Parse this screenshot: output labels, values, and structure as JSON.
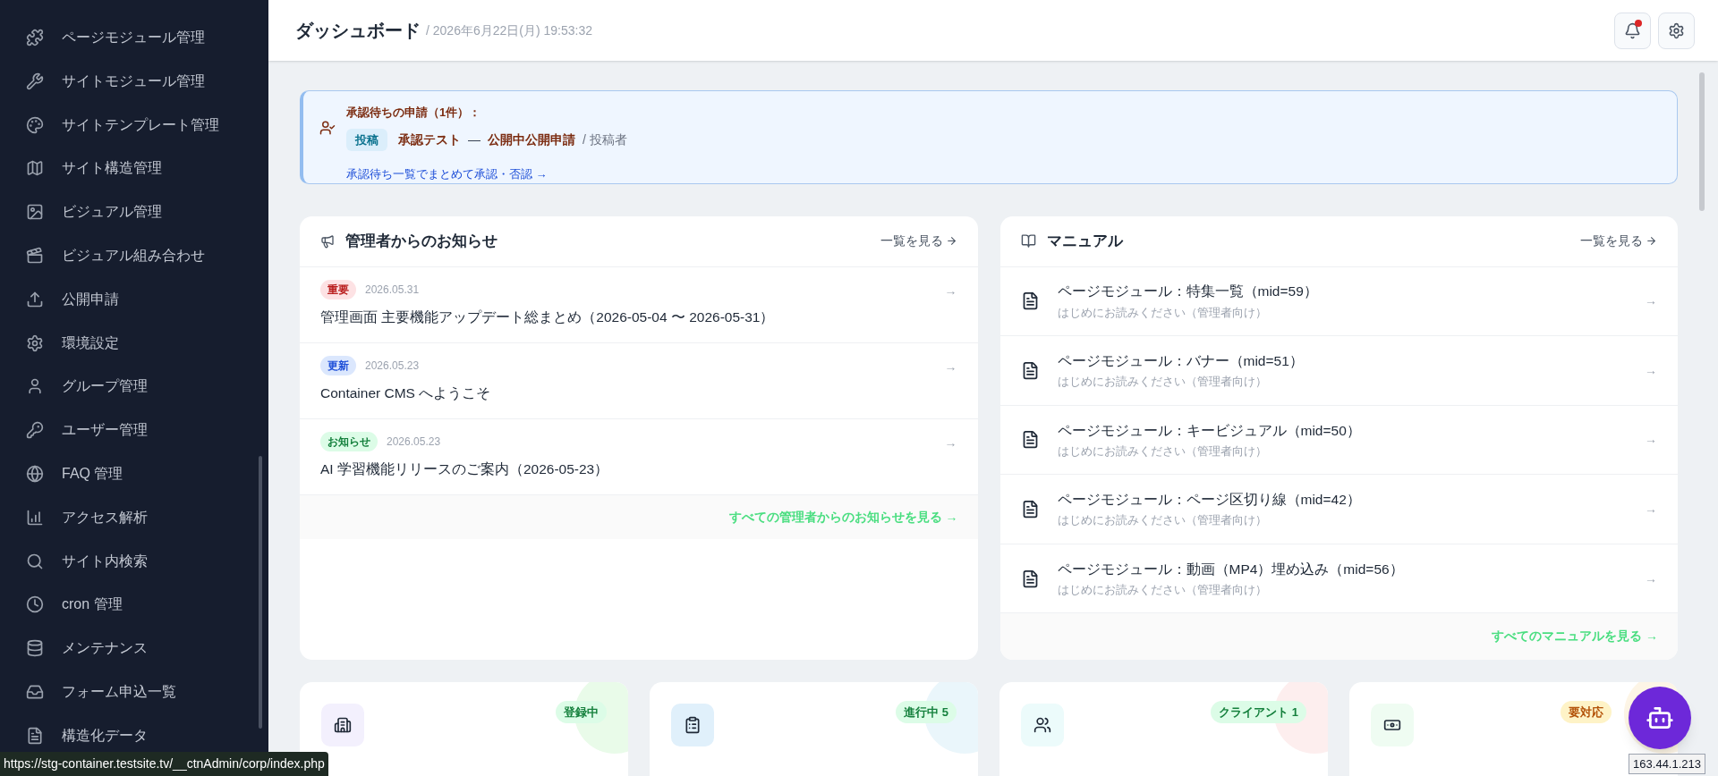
{
  "sidebar": {
    "items": [
      {
        "label": "ページモジュール管理"
      },
      {
        "label": "サイトモジュール管理"
      },
      {
        "label": "サイトテンプレート管理"
      },
      {
        "label": "サイト構造管理"
      },
      {
        "label": "ビジュアル管理"
      },
      {
        "label": "ビジュアル組み合わせ"
      },
      {
        "label": "公開申請"
      },
      {
        "label": "環境設定"
      },
      {
        "label": "グループ管理"
      },
      {
        "label": "ユーザー管理"
      },
      {
        "label": "FAQ 管理"
      },
      {
        "label": "アクセス解析"
      },
      {
        "label": "サイト内検索"
      },
      {
        "label": "cron 管理"
      },
      {
        "label": "メンテナンス"
      },
      {
        "label": "フォーム申込一覧"
      },
      {
        "label": "構造化データ"
      }
    ]
  },
  "header": {
    "title": "ダッシュボード",
    "datetime": "/ 2026年6月22日(月) 19:53:32",
    "notifications_unread": true
  },
  "approval": {
    "title": "承認待ちの申請（1件）：",
    "items": [
      {
        "tag": "投稿",
        "title": "承認テスト",
        "separator": "—",
        "status": "公開中公開申請",
        "role": "/ 投稿者"
      }
    ],
    "link": "承認待ち一覧でまとめて承認・否認 →"
  },
  "news": {
    "title": "管理者からのお知らせ",
    "view_all": "一覧を見る",
    "items": [
      {
        "kind": "important",
        "tag": "重要",
        "date": "2026.05.31",
        "title": "管理画面 主要機能アップデート総まとめ（2026-05-04 〜 2026-05-31）",
        "arrow": "→"
      },
      {
        "kind": "update",
        "tag": "更新",
        "date": "2026.05.23",
        "title": "Container CMS へようこそ",
        "arrow": "→"
      },
      {
        "kind": "notice",
        "tag": "お知らせ",
        "date": "2026.05.23",
        "title": "AI 学習機能リリースのご案内（2026-05-23）",
        "arrow": "→"
      }
    ],
    "footer_link": "すべての管理者からのお知らせを見る →"
  },
  "manual": {
    "title": "マニュアル",
    "view_all": "一覧を見る",
    "items": [
      {
        "title": "ページモジュール：特集一覧（mid=59）",
        "subtitle": "はじめにお読みください（管理者向け）",
        "arrow": "→"
      },
      {
        "title": "ページモジュール：バナー（mid=51）",
        "subtitle": "はじめにお読みください（管理者向け）",
        "arrow": "→"
      },
      {
        "title": "ページモジュール：キービジュアル（mid=50）",
        "subtitle": "はじめにお読みください（管理者向け）",
        "arrow": "→"
      },
      {
        "title": "ページモジュール：ページ区切り線（mid=42）",
        "subtitle": "はじめにお読みください（管理者向け）",
        "arrow": "→"
      },
      {
        "title": "ページモジュール：動画（MP4）埋め込み（mid=56）",
        "subtitle": "はじめにお読みください（管理者向け）",
        "arrow": "→"
      }
    ],
    "footer_link": "すべてのマニュアルを見る →"
  },
  "stats": [
    {
      "kind": "sites",
      "badge": "登録中"
    },
    {
      "kind": "projects",
      "badge": "進行中 5"
    },
    {
      "kind": "people",
      "badge": "クライアント 1"
    },
    {
      "kind": "billing",
      "badge": "要対応"
    }
  ],
  "status_url": "https://stg-container.testsite.tv/__ctnAdmin/corp/index.php",
  "ip_badge": "163.44.1.213"
}
